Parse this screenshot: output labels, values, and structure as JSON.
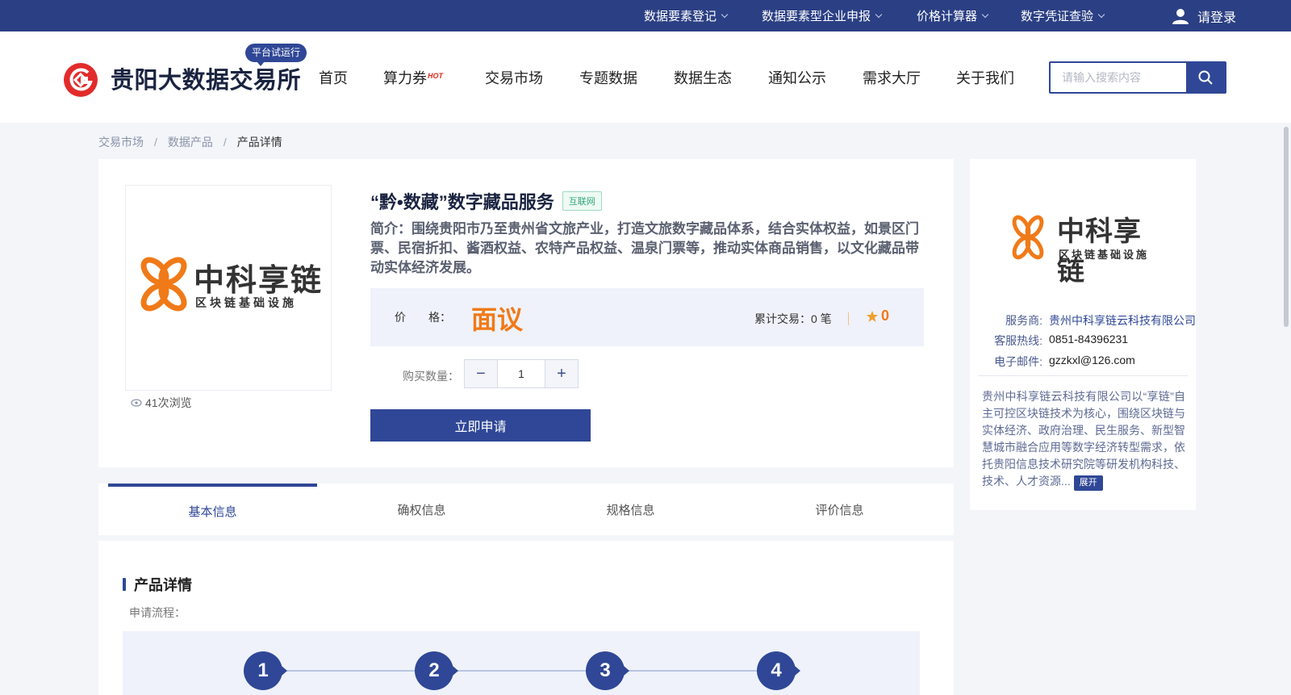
{
  "topbar": {
    "items": [
      {
        "label": "数据要素登记"
      },
      {
        "label": "数据要素型企业申报"
      },
      {
        "label": "价格计算器"
      },
      {
        "label": "数字凭证查验"
      }
    ],
    "login": "请登录"
  },
  "header": {
    "brand": "贵阳大数据交易所",
    "badge": "平台试运行",
    "nav": [
      {
        "label": "首页"
      },
      {
        "label": "算力券"
      },
      {
        "label": "交易市场"
      },
      {
        "label": "专题数据"
      },
      {
        "label": "数据生态"
      },
      {
        "label": "通知公示"
      },
      {
        "label": "需求大厅"
      },
      {
        "label": "关于我们"
      }
    ],
    "hot": "HOT",
    "search_placeholder": "请输入搜索内容"
  },
  "breadcrumb": {
    "items": [
      "交易市场",
      "数据产品",
      "产品详情"
    ],
    "sep": "/"
  },
  "product": {
    "title": "“黔•数藏”数字藏品服务",
    "tag": "互联网",
    "intro": "简介：围绕贵阳市乃至贵州省文旅产业，打造文旅数字藏品体系，结合实体权益，如景区门票、民宿折扣、酱酒权益、农特产品权益、温泉门票等，推动实体商品销售，以文化藏品带动实体经济发展。",
    "views": "41次浏览",
    "price_label": "价　　格：",
    "price_value": "面议",
    "trade_label": "累计交易：",
    "trade_value": "0 笔",
    "rating": "0",
    "qty_label": "购买数量：",
    "qty_minus": "−",
    "qty_value": "1",
    "qty_plus": "+",
    "apply": "立即申请",
    "logo_cn": "中科享链",
    "logo_sub": "区块链基础设施"
  },
  "tabs": [
    {
      "label": "基本信息"
    },
    {
      "label": "确权信息"
    },
    {
      "label": "规格信息"
    },
    {
      "label": "评价信息"
    }
  ],
  "detail": {
    "title": "产品详情",
    "flow_label": "申请流程：",
    "steps": [
      "1",
      "2",
      "3",
      "4"
    ]
  },
  "provider": {
    "logo_cn": "中科享链",
    "logo_sub": "区块链基础设施",
    "rows": [
      {
        "k": "服务商:",
        "v": "贵州中科享链云科技有限公司"
      },
      {
        "k": "客服热线:",
        "v": "0851-84396231"
      },
      {
        "k": "电子邮件:",
        "v": "gzzkxl@126.com"
      }
    ],
    "desc": "贵州中科享链云科技有限公司以“享链”自主可控区块链技术为核心，围绕区块链与实体经济、政府治理、民生服务、新型智慧城市融合应用等数字经济转型需求，依托贵阳信息技术研究院等研发机构科技、技术、人才资源...",
    "expand": "展开"
  },
  "colors": {
    "primary": "#2f4796",
    "topbar": "#2b3f84",
    "accent": "#f07a18"
  }
}
